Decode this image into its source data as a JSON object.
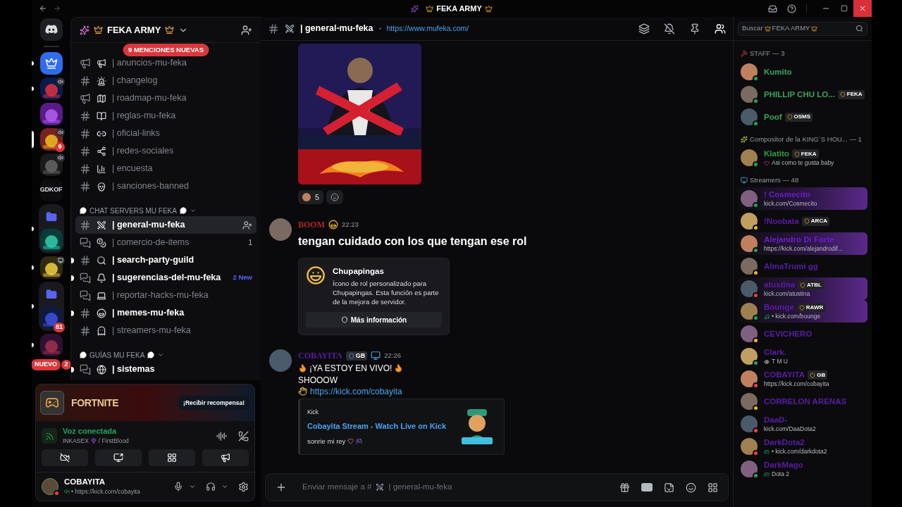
{
  "window": {
    "title": "FEKA ARMY"
  },
  "servers": [
    {
      "kind": "home",
      "selected": false,
      "unread": false
    },
    {
      "kind": "icon",
      "selected": false,
      "unread": true
    },
    {
      "kind": "icon",
      "selected": false,
      "unread": true,
      "voice": true
    },
    {
      "kind": "icon",
      "selected": false,
      "unread": false
    },
    {
      "kind": "icon",
      "selected": true,
      "unread": false,
      "voice": true,
      "badge": "9"
    },
    {
      "kind": "icon",
      "selected": false,
      "unread": false,
      "voice": true
    },
    {
      "kind": "text",
      "label": "GDKOF",
      "selected": false,
      "unread": false
    },
    {
      "kind": "folder",
      "selected": false,
      "unread": true
    },
    {
      "kind": "icon",
      "selected": false,
      "unread": true,
      "screen": true
    },
    {
      "kind": "folder",
      "selected": false,
      "unread": true,
      "badge": "81"
    },
    {
      "kind": "icon",
      "selected": false,
      "unread": true
    },
    {
      "kind": "new",
      "label": "NUEVO",
      "badge": "2",
      "selected": false,
      "unread": false
    }
  ],
  "sidebar": {
    "server_name": "FEKA ARMY",
    "mentions": "9 MENCIONES NUEVAS",
    "channels": [
      {
        "kind": "announcement",
        "name": "| anuncios-mu-feka",
        "selected": false,
        "unread": false
      },
      {
        "kind": "text",
        "name": "| changelog",
        "selected": false,
        "unread": false
      },
      {
        "kind": "announcement",
        "name": "| roadmap-mu-feka",
        "selected": false,
        "unread": false
      },
      {
        "kind": "text",
        "name": "| reglas-mu-feka",
        "selected": false,
        "unread": false
      },
      {
        "kind": "text",
        "name": "| oficial-links",
        "selected": false,
        "unread": false
      },
      {
        "kind": "text",
        "name": "| redes-sociales",
        "selected": false,
        "unread": false
      },
      {
        "kind": "text",
        "name": "| encuesta",
        "selected": false,
        "unread": false
      },
      {
        "kind": "text",
        "name": "| sanciones-banned",
        "selected": false,
        "unread": false
      }
    ],
    "categories": [
      {
        "name": "CHAT SERVERS MU FEKA",
        "expanded": true,
        "channels": [
          {
            "kind": "text",
            "name": "| general-mu-feka",
            "selected": true,
            "unread": false
          },
          {
            "kind": "forum",
            "name": "| comercio-de-items",
            "selected": false,
            "unread": false,
            "badge": "1"
          },
          {
            "kind": "text",
            "name": "| search-party-guild",
            "selected": false,
            "unread": true
          },
          {
            "kind": "forum",
            "name": "| sugerencias-del-mu-feka",
            "selected": false,
            "unread": true,
            "new": "2 New"
          },
          {
            "kind": "forum",
            "name": "| reportar-hacks-mu-feka",
            "selected": false,
            "unread": false
          },
          {
            "kind": "text",
            "name": "| memes-mu-feka",
            "selected": false,
            "unread": true
          },
          {
            "kind": "text",
            "name": "| streamers-mu-feka",
            "selected": false,
            "unread": false
          }
        ]
      },
      {
        "name": "GUÍAS MU FEKA",
        "expanded": true,
        "channels": [
          {
            "kind": "forum",
            "name": "| sistemas",
            "selected": false,
            "unread": true
          }
        ]
      }
    ]
  },
  "panel": {
    "promo": {
      "game": "FORTNITE",
      "button": "¡Recibir recompensa!"
    },
    "voice": {
      "status": "Voz conectada",
      "user": "INKASEX",
      "channel": "/ FirstBlood"
    },
    "user": {
      "name": "COBAYITA",
      "status": "• https://kick.com/cobayita"
    }
  },
  "channel": {
    "name": "| general-mu-feka",
    "topic": "https://www.mufeka.com/"
  },
  "messages": [
    {
      "reactions": [
        {
          "count": "5"
        }
      ]
    },
    {
      "kind": "message",
      "author": "BOOM",
      "color": "#b3262d",
      "time": "22:23",
      "lines": [
        {
          "kind": "large",
          "text": "tengan cuidado con los que tengan ese rol"
        }
      ],
      "role_card": {
        "title": "Chupapingas",
        "text": "Ícono de rol personalizado para Chupapingas. Esta función es parte de la mejora de servidor.",
        "button": "Más información"
      }
    },
    {
      "kind": "message",
      "author": "COBAYITA",
      "color": "#5b1ca8",
      "tag": "GB",
      "time": "22:26",
      "lines": [
        {
          "kind": "live",
          "text": "¡YA ESTOY EN VIVO!"
        },
        {
          "kind": "plain",
          "text": "SHOOOW"
        },
        {
          "kind": "link",
          "text": "https://kick.com/cobayita"
        }
      ],
      "embed": {
        "provider": "Kick",
        "title": "Cobayita Stream - Watch Live on Kick",
        "text": "sonrie mi rey"
      }
    }
  ],
  "composer": {
    "prefix": "Enviar mensaje a #",
    "channel": "| general-mu-feka"
  },
  "members": {
    "search": {
      "label": "Buscar",
      "server": "FEKA ARMY"
    },
    "groups": [
      {
        "title": "STAFF — 3",
        "members": [
          {
            "name": "Kumito",
            "color": "#3ba55c",
            "presence": {
              "kind": "online"
            }
          },
          {
            "name": "PHILLIP CHU LO...",
            "color": "#3ba55c",
            "presence": {
              "kind": "online"
            },
            "tag": "FEKA"
          },
          {
            "name": "Poof",
            "color": "#3ba55c",
            "presence": {
              "kind": "online"
            },
            "tag": "OSMS"
          }
        ]
      },
      {
        "title": "Compositor de la KING`S HOU... — 1",
        "members": [
          {
            "name": "Klatito",
            "color": "#2f9e44",
            "presence": {
              "kind": "online"
            },
            "tag": "FEKA",
            "activity": {
              "kind": "heart",
              "text": "Asi como te gusta baby"
            }
          }
        ]
      },
      {
        "title": "Streamers — 48",
        "members": [
          {
            "name": "! Cosmecito",
            "color": "#6a1fd0",
            "presence": {
              "kind": "online"
            },
            "activity": {
              "kind": "text",
              "text": "kick.com/Cosmecito"
            },
            "banner": true
          },
          {
            "name": "!Noobata",
            "color": "#5b1ca8",
            "presence": {
              "kind": "idle"
            },
            "tag": "ARCA"
          },
          {
            "name": "Alejandro Di Forte",
            "color": "#6a1fd0",
            "presence": {
              "kind": "online"
            },
            "activity": {
              "kind": "text",
              "text": "https://kick.com/alejandrodif..."
            },
            "banner": true
          },
          {
            "name": "AlmaTrumi gg",
            "color": "#5b1ca8",
            "presence": {
              "kind": "idle"
            }
          },
          {
            "name": "atustina",
            "color": "#5b1ca8",
            "presence": {
              "kind": "dnd"
            },
            "tag": "ATBL",
            "activity": {
              "kind": "text",
              "text": "kick.com/atustina"
            },
            "banner": true
          },
          {
            "name": "Bounge",
            "color": "#5b1ca8",
            "presence": {
              "kind": "online"
            },
            "tag": "RAWR",
            "activity": {
              "kind": "music",
              "text": "• kick.com/bounge"
            },
            "banner": true
          },
          {
            "name": "CEVICHERO",
            "color": "#5b1ca8",
            "presence": {
              "kind": "idle"
            }
          },
          {
            "name": "Clark.",
            "color": "#5b1ca8",
            "presence": {
              "kind": "online"
            },
            "activity": {
              "kind": "eye",
              "text": "T M U"
            }
          },
          {
            "name": "COBAYITA",
            "color": "#5b1ca8",
            "presence": {
              "kind": "dnd"
            },
            "tag": "GB",
            "activity": {
              "kind": "text",
              "text": "https://kick.com/cobayita"
            }
          },
          {
            "name": "CORRELON ARENAS",
            "color": "#5b1ca8",
            "presence": {
              "kind": "idle"
            }
          },
          {
            "name": "DaaD-",
            "color": "#5b1ca8",
            "presence": {
              "kind": "dnd"
            },
            "activity": {
              "kind": "text",
              "text": "kick.com/DaaDota2"
            }
          },
          {
            "name": "DarkDota2",
            "color": "#5b1ca8",
            "presence": {
              "kind": "dnd"
            },
            "activity": {
              "kind": "game",
              "text": "• kick.com/darkdota2"
            }
          },
          {
            "name": "DarkMago",
            "color": "#5b1ca8",
            "presence": {
              "kind": "online"
            },
            "activity": {
              "kind": "game",
              "text": "Dota 2"
            }
          }
        ]
      }
    ]
  }
}
